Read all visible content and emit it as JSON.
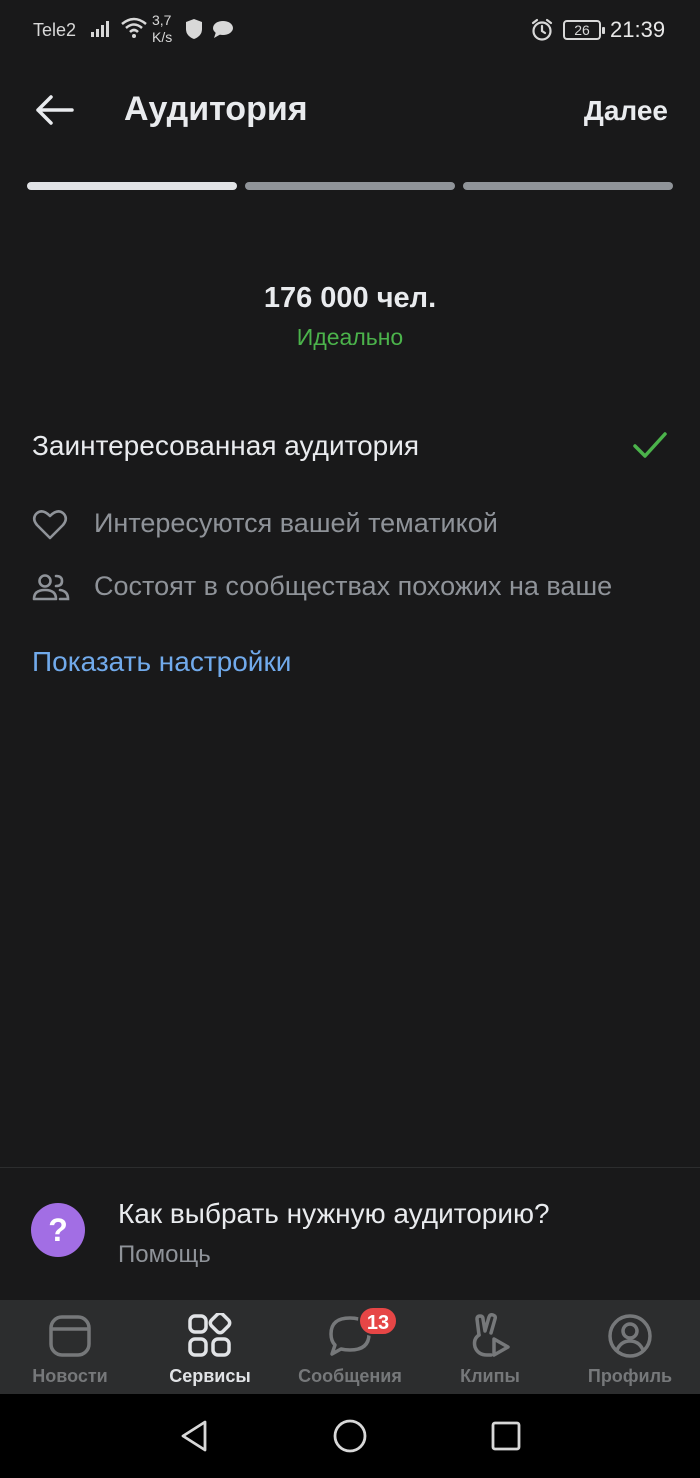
{
  "status_bar": {
    "carrier": "Tele2",
    "net_speed_line1": "3,7",
    "net_speed_line2": "K/s",
    "battery": "26",
    "time": "21:39"
  },
  "header": {
    "title": "Аудитория",
    "next_label": "Далее"
  },
  "progress": {
    "steps_total": 3,
    "current_step": 1
  },
  "audience": {
    "size": "176 000 чел.",
    "rating": "Идеально",
    "rating_color": "#4bb34b"
  },
  "option": {
    "label": "Заинтересованная аудитория",
    "checked": true
  },
  "criteria": [
    {
      "icon": "heart-icon",
      "text": "Интересуются вашей тематикой"
    },
    {
      "icon": "users-icon",
      "text": "Состоят в сообществах похожих на ваше"
    }
  ],
  "show_settings_label": "Показать настройки",
  "help": {
    "icon_glyph": "?",
    "title": "Как выбрать нужную аудиторию?",
    "subtitle": "Помощь"
  },
  "tabbar": {
    "items": [
      {
        "label": "Новости",
        "icon": "news-icon"
      },
      {
        "label": "Сервисы",
        "icon": "services-icon",
        "active": true
      },
      {
        "label": "Сообщения",
        "icon": "messages-icon",
        "badge": "13"
      },
      {
        "label": "Клипы",
        "icon": "clips-icon"
      },
      {
        "label": "Профиль",
        "icon": "profile-icon"
      }
    ]
  },
  "colors": {
    "background": "#19191a",
    "accent_link": "#71aaeb",
    "success": "#4bb34b",
    "badge": "#e64646",
    "help_icon_bg": "#a26ee4"
  }
}
